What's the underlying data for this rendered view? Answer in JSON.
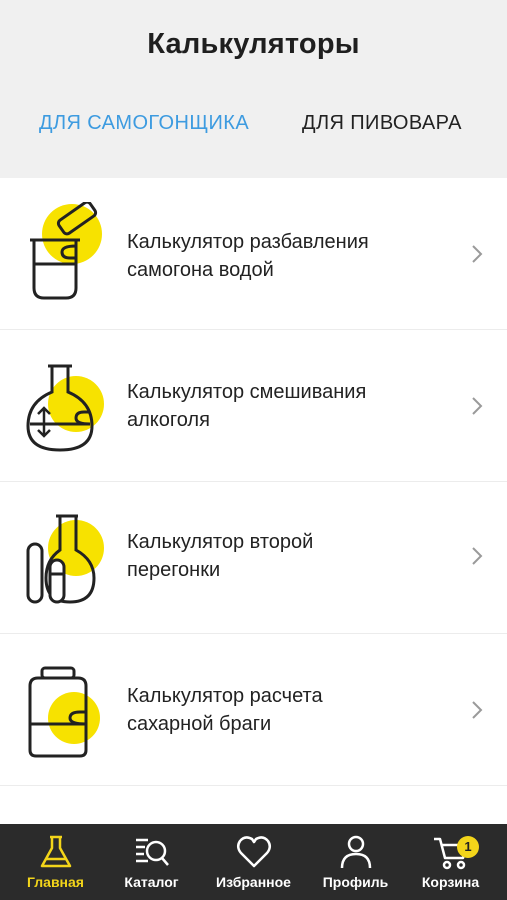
{
  "header": {
    "title": "Калькуляторы",
    "tabs": [
      {
        "label": "ДЛЯ САМОГОНЩИКА",
        "active": true
      },
      {
        "label": "ДЛЯ ПИВОВАРА",
        "active": false
      }
    ]
  },
  "calculators": [
    {
      "label_line1": "Калькулятор разбавления",
      "label_line2": "самогона водой",
      "icon": "beaker-pour-icon"
    },
    {
      "label_line1": "Калькулятор смешивания",
      "label_line2": "алкоголя",
      "icon": "round-flask-icon"
    },
    {
      "label_line1": "Калькулятор второй",
      "label_line2": "перегонки",
      "icon": "flask-tubes-icon"
    },
    {
      "label_line1": "Калькулятор расчета",
      "label_line2": "сахарной браги",
      "icon": "jar-icon"
    }
  ],
  "bottom_nav": {
    "items": [
      {
        "label": "Главная",
        "icon": "flask-icon",
        "active": true
      },
      {
        "label": "Каталог",
        "icon": "catalog-search-icon",
        "active": false
      },
      {
        "label": "Избранное",
        "icon": "heart-icon",
        "active": false
      },
      {
        "label": "Профиль",
        "icon": "user-icon",
        "active": false
      },
      {
        "label": "Корзина",
        "icon": "cart-icon",
        "active": false
      }
    ],
    "cart_count": "1"
  },
  "colors": {
    "accent_blue": "#3d9be0",
    "accent_yellow": "#f3d51a",
    "nav_background": "#2b2b2b",
    "header_background": "#f0f0f0"
  }
}
